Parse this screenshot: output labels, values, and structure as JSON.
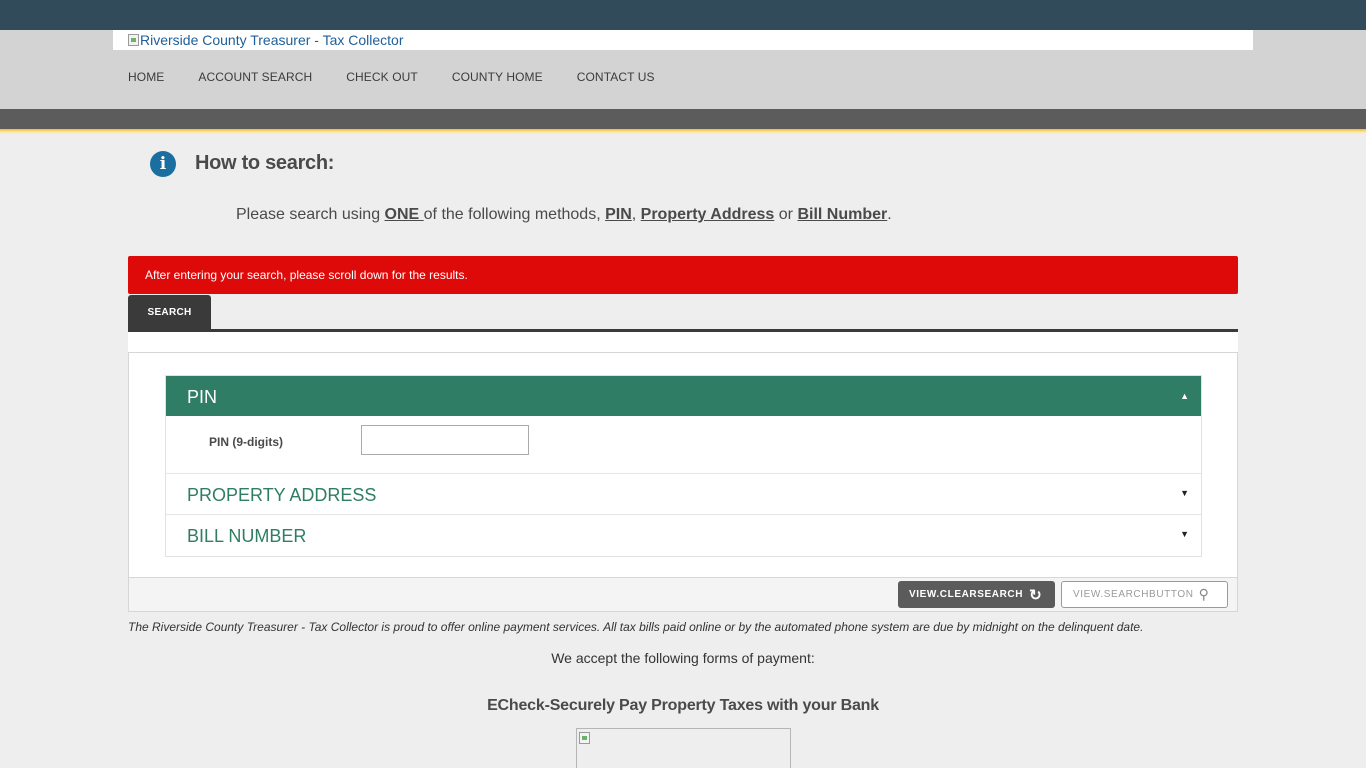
{
  "header": {
    "logo_alt": "Riverside County Treasurer - Tax Collector",
    "nav": [
      {
        "label": "HOME"
      },
      {
        "label": "ACCOUNT SEARCH"
      },
      {
        "label": "CHECK OUT"
      },
      {
        "label": "COUNTY HOME"
      },
      {
        "label": "CONTACT US"
      }
    ]
  },
  "intro": {
    "title": "How to search:",
    "text_before": "Please search using ",
    "one": "ONE ",
    "text_mid": "of the following methods, ",
    "pin": "PIN",
    "comma": ", ",
    "property_address": "Property Address",
    "or": " or ",
    "bill_number": "Bill Number",
    "period": "."
  },
  "alert": {
    "text": "After entering your search, please scroll down for the results."
  },
  "tabs": [
    {
      "label": "SEARCH",
      "active": true
    }
  ],
  "accordion": {
    "pin": {
      "title": "PIN",
      "field_label": "PIN (9-digits)",
      "value": "",
      "caret": "▲"
    },
    "property_address": {
      "title": "PROPERTY ADDRESS",
      "caret": "▼"
    },
    "bill_number": {
      "title": "BILL NUMBER",
      "caret": "▼"
    }
  },
  "buttons": {
    "clear": "VIEW.CLEARSEARCH",
    "clear_icon": "↻",
    "search": "VIEW.SEARCHBUTTON",
    "search_icon": "⚲"
  },
  "footer": {
    "disclaimer": "The Riverside County Treasurer - Tax Collector is proud to offer online payment services. All tax bills paid online or by the automated phone system are due by midnight on the delinquent date.",
    "accept": "We accept the following forms of payment:",
    "echeck": "ECheck-Securely Pay Property Taxes with your Bank"
  },
  "colors": {
    "topbar": "#324b5a",
    "accent_green": "#2f7d64",
    "alert_red": "#de0a0a",
    "gold": "#f4b820"
  }
}
